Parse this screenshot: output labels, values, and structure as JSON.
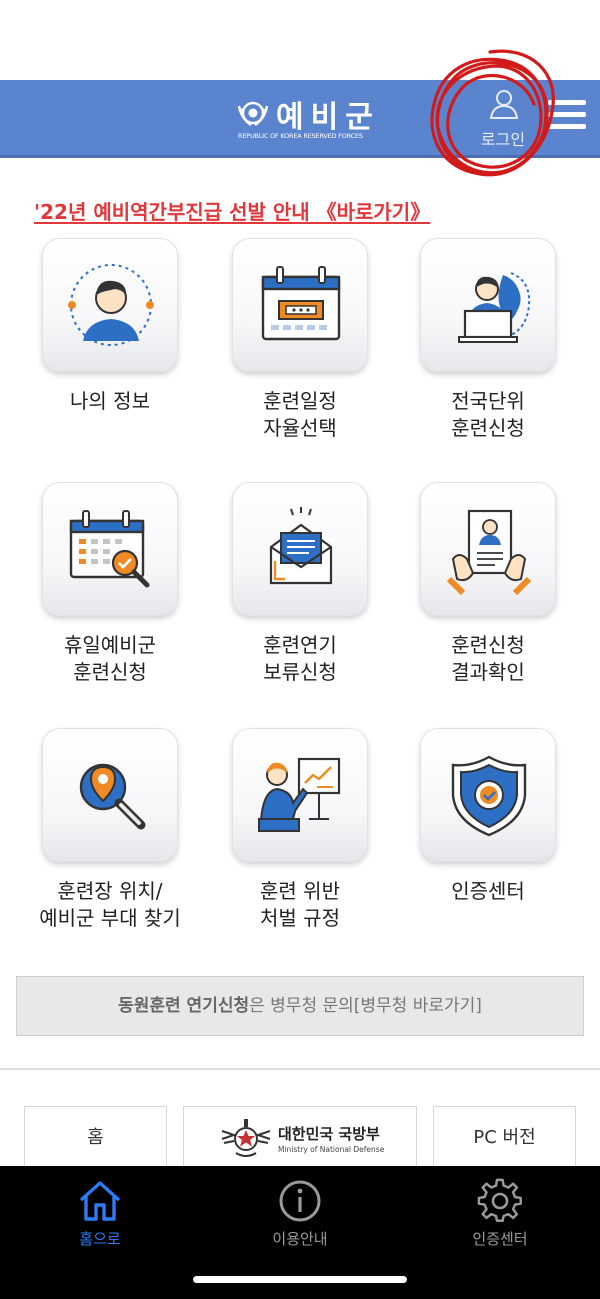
{
  "header": {
    "logo_title": "예비군",
    "logo_subtitle": "REPUBLIC OF KOREA RESERVED FORCES",
    "login_label": "로그인"
  },
  "notice": {
    "text": "'22년 예비역간부진급 선발 안내 《바로가기》"
  },
  "tiles": [
    {
      "lines": [
        "나의 정보"
      ],
      "icon": "profile-icon"
    },
    {
      "lines": [
        "훈련일정",
        "자율선택"
      ],
      "icon": "calendar-icon"
    },
    {
      "lines": [
        "전국단위",
        "훈련신청"
      ],
      "icon": "nationwide-laptop-icon"
    },
    {
      "lines": [
        "휴일예비군",
        "훈련신청"
      ],
      "icon": "holiday-calendar-icon"
    },
    {
      "lines": [
        "훈련연기",
        "보류신청"
      ],
      "icon": "envelope-icon"
    },
    {
      "lines": [
        "훈련신청",
        "결과확인"
      ],
      "icon": "document-check-icon"
    },
    {
      "lines": [
        "훈련장 위치/",
        "예비군 부대 찾기"
      ],
      "icon": "map-search-icon"
    },
    {
      "lines": [
        "훈련 위반",
        "처벌 규정"
      ],
      "icon": "presenter-icon"
    },
    {
      "lines": [
        "인증센터"
      ],
      "icon": "shield-check-icon"
    }
  ],
  "mobilization": {
    "bold_text": "동원훈련 연기신청",
    "rest_text": "은 병무청 문의[병무청 바로가기]"
  },
  "footer": {
    "home_label": "홈",
    "mnd_title": "대한민국 국방부",
    "mnd_subtitle": "Ministry of National Defense",
    "pc_label": "PC 버전"
  },
  "tabbar": {
    "tabs": [
      {
        "label": "홈으로",
        "icon": "home-icon",
        "active": true
      },
      {
        "label": "이용안내",
        "icon": "info-icon",
        "active": false
      },
      {
        "label": "인증센터",
        "icon": "gear-icon",
        "active": false
      }
    ]
  },
  "colors": {
    "header_blue": "#5b84cf",
    "notice_red": "#e0373b",
    "tab_active": "#2b7cf6",
    "icon_blue": "#2d6fc4",
    "icon_orange": "#f08a24"
  }
}
